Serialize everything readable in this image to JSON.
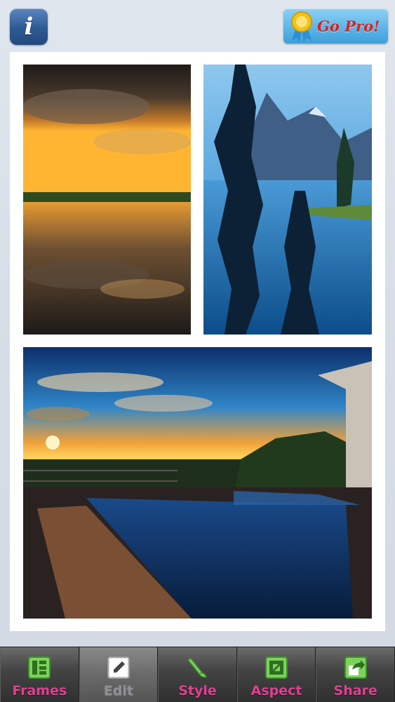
{
  "header": {
    "info_glyph": "i",
    "gopro_label": "Go Pro!"
  },
  "collage": {
    "photos": [
      {
        "name": "sunset-lake-reflection"
      },
      {
        "name": "mountain-lake-pines"
      },
      {
        "name": "infinity-pool-sunset"
      }
    ]
  },
  "toolbar": {
    "tabs": [
      {
        "label": "Frames",
        "icon": "frames-icon",
        "active": false
      },
      {
        "label": "Edit",
        "icon": "edit-icon",
        "active": true
      },
      {
        "label": "Style",
        "icon": "style-icon",
        "active": false
      },
      {
        "label": "Aspect",
        "icon": "aspect-icon",
        "active": false
      },
      {
        "label": "Share",
        "icon": "share-icon",
        "active": false
      }
    ]
  },
  "colors": {
    "tab_label": "#e0408f",
    "tab_icon": "#7bd35b",
    "gopro_text": "#d9231c"
  }
}
